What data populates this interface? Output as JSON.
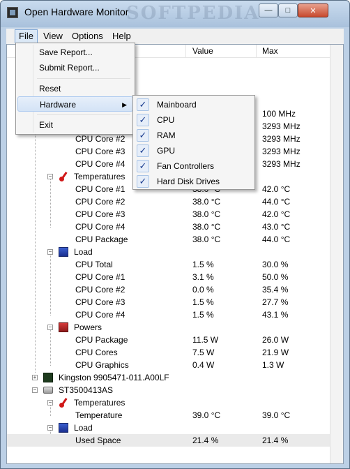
{
  "window": {
    "title": "Open Hardware Monitor",
    "watermark": "SOFTPEDIA"
  },
  "menubar": {
    "file": "File",
    "view": "View",
    "options": "Options",
    "help": "Help"
  },
  "columns": {
    "value": "Value",
    "max": "Max"
  },
  "file_menu": {
    "save_report": "Save Report...",
    "submit_report": "Submit Report...",
    "reset": "Reset",
    "hardware": "Hardware",
    "exit": "Exit"
  },
  "hardware_submenu": [
    {
      "label": "Mainboard",
      "checked": true
    },
    {
      "label": "CPU",
      "checked": true
    },
    {
      "label": "RAM",
      "checked": true
    },
    {
      "label": "GPU",
      "checked": true
    },
    {
      "label": "Fan Controllers",
      "checked": true
    },
    {
      "label": "Hard Disk Drives",
      "checked": true
    }
  ],
  "tree": {
    "partial_rows": [
      {
        "name": "",
        "value": "",
        "max": "100 MHz"
      },
      {
        "name": "",
        "value": "",
        "max": "3293 MHz"
      },
      {
        "name": "CPU Core #2",
        "value": "",
        "max": "3293 MHz"
      },
      {
        "name": "CPU Core #3",
        "value": "",
        "max": "3293 MHz"
      },
      {
        "name": "CPU Core #4",
        "value": "",
        "max": "3293 MHz"
      }
    ],
    "temperatures": {
      "label": "Temperatures",
      "rows": [
        {
          "name": "CPU Core #1",
          "value": "38.0 °C",
          "max": "42.0 °C"
        },
        {
          "name": "CPU Core #2",
          "value": "38.0 °C",
          "max": "44.0 °C"
        },
        {
          "name": "CPU Core #3",
          "value": "38.0 °C",
          "max": "42.0 °C"
        },
        {
          "name": "CPU Core #4",
          "value": "38.0 °C",
          "max": "43.0 °C"
        },
        {
          "name": "CPU Package",
          "value": "38.0 °C",
          "max": "44.0 °C"
        }
      ]
    },
    "load": {
      "label": "Load",
      "rows": [
        {
          "name": "CPU Total",
          "value": "1.5 %",
          "max": "30.0 %"
        },
        {
          "name": "CPU Core #1",
          "value": "3.1 %",
          "max": "50.0 %"
        },
        {
          "name": "CPU Core #2",
          "value": "0.0 %",
          "max": "35.4 %"
        },
        {
          "name": "CPU Core #3",
          "value": "1.5 %",
          "max": "27.7 %"
        },
        {
          "name": "CPU Core #4",
          "value": "1.5 %",
          "max": "43.1 %"
        }
      ]
    },
    "powers": {
      "label": "Powers",
      "rows": [
        {
          "name": "CPU Package",
          "value": "11.5 W",
          "max": "26.0 W"
        },
        {
          "name": "CPU Cores",
          "value": "7.5 W",
          "max": "21.9 W"
        },
        {
          "name": "CPU Graphics",
          "value": "0.4 W",
          "max": "1.3 W"
        }
      ]
    },
    "ram_device": "Kingston 9905471-011.A00LF",
    "hdd_device": "ST3500413AS",
    "hdd_temperatures": {
      "label": "Temperatures",
      "rows": [
        {
          "name": "Temperature",
          "value": "39.0 °C",
          "max": "39.0 °C"
        }
      ]
    },
    "hdd_load": {
      "label": "Load",
      "rows": [
        {
          "name": "Used Space",
          "value": "21.4 %",
          "max": "21.4 %"
        }
      ]
    }
  }
}
